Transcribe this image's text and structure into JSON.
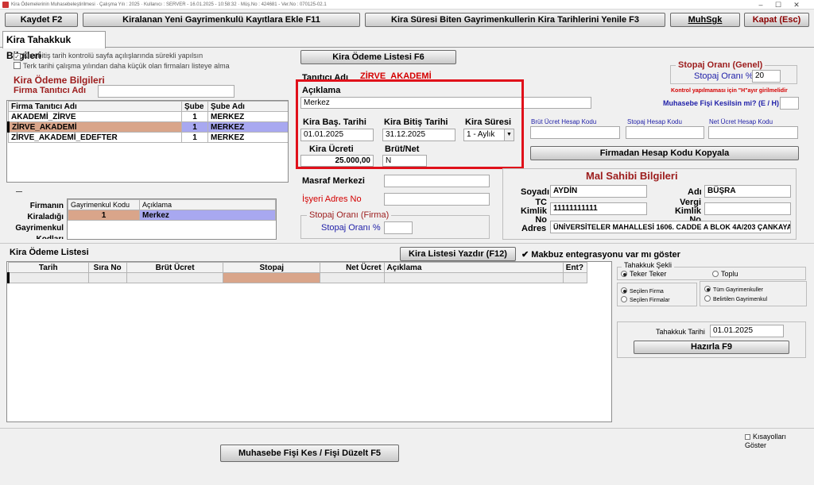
{
  "window": {
    "title": "Kira Ödemelerinin Muhasebeleştirilmesi  ·  Çalışma Yılı : 2025  ·  Kullanıcı : SERVER - 16.01.2025 - 10:58:32  ·  Müş.No : 424681 - Ver.No : 070125-02.1",
    "min": "–",
    "max": "☐",
    "close": "✕"
  },
  "toolbar": {
    "save": "Kaydet F2",
    "add_new": "Kiralanan Yeni Gayrimenkulü Kayıtlara Ekle F11",
    "renew": "Kira Süresi Biten Gayrimenkullerin Kira Tarihlerini Yenile F3",
    "muhsgk": "MuhSgk",
    "close": "Kapat (Esc)"
  },
  "tab": {
    "label": "Kira Tahakkuk Bilgileri"
  },
  "options": {
    "check1": "Kira bitiş tarih kontrolü sayfa açılışlarında sürekli yapılsın",
    "check1_checked": true,
    "check2": "Terk tarihi çalışma yılından daha küçük olan firmaları listeye alma",
    "check2_checked": false
  },
  "kira_odeme": {
    "heading": "Kira Ödeme Bilgileri",
    "firma_tanitici_label": "Firma Tanıtıcı Adı",
    "firma_tanitici_value": ""
  },
  "firma_grid": {
    "headers": [
      "Firma Tanıtıcı Adı",
      "Şube",
      "Şube Adı"
    ],
    "rows": [
      {
        "name": "AKADEMİ_ZİRVE",
        "sube": "1",
        "sube_adi": "MERKEZ"
      },
      {
        "name": "ZİRVE_AKADEMİ",
        "sube": "1",
        "sube_adi": "MERKEZ"
      },
      {
        "name": "ZİRVE_AKADEMİ_EDEFTER",
        "sube": "1",
        "sube_adi": "MERKEZ"
      }
    ]
  },
  "gayrimenkul": {
    "side_label": "Firmanın Kiraladığı Gayrimenkul Kodları",
    "headers": [
      "Gayrimenkul Kodu",
      "Açıklama"
    ],
    "rows": [
      {
        "kod": "1",
        "aciklama": "Merkez"
      }
    ]
  },
  "kira_odeme_listesi_btn": "Kira Ödeme Listesi F6",
  "tanitici": {
    "label": "Tanıtıcı Adı",
    "value": "ZİRVE_AKADEMİ"
  },
  "aciklama": {
    "label": "Açıklama",
    "value": "Merkez"
  },
  "kira_bas": {
    "label": "Kira Baş. Tarihi",
    "value": "01.01.2025"
  },
  "kira_bitis": {
    "label": "Kira Bitiş Tarihi",
    "value": "31.12.2025"
  },
  "kira_suresi": {
    "label": "Kira Süresi",
    "value": "1 - Aylık"
  },
  "kira_ucreti": {
    "label": "Kira Ücreti",
    "value": "25.000,00"
  },
  "brut_net": {
    "label": "Brüt/Net",
    "value": "N"
  },
  "masraf_merkezi": {
    "label": "Masraf Merkezi",
    "value": ""
  },
  "isyeri_adres_no": {
    "label": "İşyeri Adres No",
    "value": ""
  },
  "stopaj_firma": {
    "title": "Stopaj Oranı (Firma)",
    "label": "Stopaj Oranı %",
    "value": ""
  },
  "stopaj_genel": {
    "title": "Stopaj Oranı (Genel)",
    "label": "Stopaj Oranı %",
    "value": "20"
  },
  "kontrol_note": "Kontrol yapılmaması için \"H\"ayır girilmelidir",
  "muhasebe_fisi": {
    "label": "Muhasebe Fişi Kesilsin mi? (E / H)",
    "value": ""
  },
  "hesap_kodlari": {
    "brut": "Brüt Ücret Hesap Kodu",
    "stopaj": "Stopaj Hesap Kodu",
    "net": "Net Ücret Hesap Kodu",
    "copy_btn": "Firmadan Hesap Kodu Kopyala"
  },
  "mal_sahibi": {
    "title": "Mal Sahibi Bilgileri",
    "soyadi_label": "Soyadı",
    "soyadi": "AYDİN",
    "adi_label": "Adı",
    "adi": "BÜŞRA",
    "tc_label": "TC Kimlik No",
    "tc": "11111111111",
    "vergi_label": "Vergi Kimlik No",
    "vergi": "",
    "adres_label": "Adres",
    "adres": "ÜNİVERSİTELER MAHALLESİ 1606. CADDE A BLOK 4A/203 ÇANKAYA A"
  },
  "odeme_listesi": {
    "title": "Kira Ödeme Listesi",
    "print_btn": "Kira Listesi Yazdır (F12)",
    "makbuz_label": "Makbuz entegrasyonu var mı göster",
    "makbuz_checked": true,
    "headers": [
      "Tarih",
      "Sıra No",
      "Brüt Ücret",
      "Stopaj",
      "Net Ücret",
      "Açıklama",
      "Ent?"
    ]
  },
  "tahakkuk": {
    "title": "Tahakkuk Şekli",
    "teker": "Teker Teker",
    "toplu": "Toplu",
    "secilen_firma": "Seçilen Firma",
    "secilen_firmalar": "Seçilen Firmalar",
    "tum_gayri": "Tüm Gayrimenkuller",
    "belirtilen_gayri": "Belirtilen Gayrimenkul",
    "tarih_label": "Tahakkuk Tarihi",
    "tarih": "01.01.2025",
    "hazirla": "Hazırla F9"
  },
  "muhasebe_btn": "Muhasebe Fişi Kes / Fişi Düzelt F5",
  "kisayollari": "Kısayolları Göster",
  "colors": {
    "highlight_red": "#e0101a",
    "selected_row": "#d9a58a",
    "selected_blue": "#a8a8f0"
  }
}
